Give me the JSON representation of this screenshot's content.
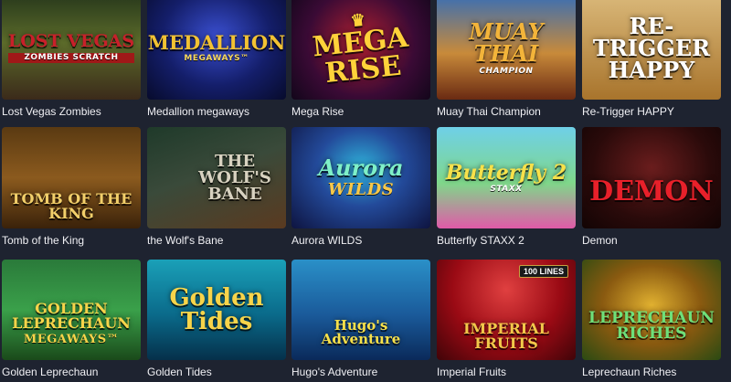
{
  "games": [
    {
      "name": "Lost Vegas Zombies",
      "art_title": "Lost Vegas",
      "art_sub": "ZOMBIES SCRATCH",
      "title_color": "#c8202a"
    },
    {
      "name": "Medallion megaways",
      "art_title": "Medallion",
      "art_sub": "MEGAWAYS™",
      "title_color": "#f2c233"
    },
    {
      "name": "Mega Rise",
      "art_title": "Mega Rise",
      "art_sub": "",
      "title_color": "#ffd23a"
    },
    {
      "name": "Muay Thai Champion",
      "art_title": "Muay Thai",
      "art_sub": "CHAMPION",
      "title_color": "#f3b43a"
    },
    {
      "name": "Re-Trigger HAPPY",
      "art_title": "Re-Trigger Happy",
      "art_sub": "",
      "title_color": "#ffffff"
    },
    {
      "name": "Tomb of the King",
      "art_title": "Tomb of the King",
      "art_sub": "",
      "title_color": "#f2cf6a"
    },
    {
      "name": "the Wolf's Bane",
      "art_title": "The Wolf's Bane",
      "art_sub": "",
      "title_color": "#d8d2c0"
    },
    {
      "name": "Aurora WILDS",
      "art_title": "Aurora",
      "art_sub": "WILDS",
      "title_color": "#7ff0c8"
    },
    {
      "name": "Butterfly STAXX 2",
      "art_title": "Butterfly 2",
      "art_sub": "STAXX",
      "title_color": "#f7e14a"
    },
    {
      "name": "Demon",
      "art_title": "Demon",
      "art_sub": "",
      "title_color": "#e8202a"
    },
    {
      "name": "Golden Leprechaun",
      "art_title": "Golden Leprechaun",
      "art_sub": "MEGAWAYS™",
      "title_color": "#f7d44a"
    },
    {
      "name": "Golden Tides",
      "art_title": "Golden Tides",
      "art_sub": "",
      "title_color": "#f7d44a"
    },
    {
      "name": "Hugo's Adventure",
      "art_title": "Hugo's Adventure",
      "art_sub": "",
      "title_color": "#f7e04a"
    },
    {
      "name": "Imperial Fruits",
      "art_title": "Imperial Fruits",
      "art_sub": "100 LINES",
      "title_color": "#f2c84a"
    },
    {
      "name": "Leprechaun Riches",
      "art_title": "Leprechaun Riches",
      "art_sub": "",
      "title_color": "#6ee07a"
    }
  ]
}
